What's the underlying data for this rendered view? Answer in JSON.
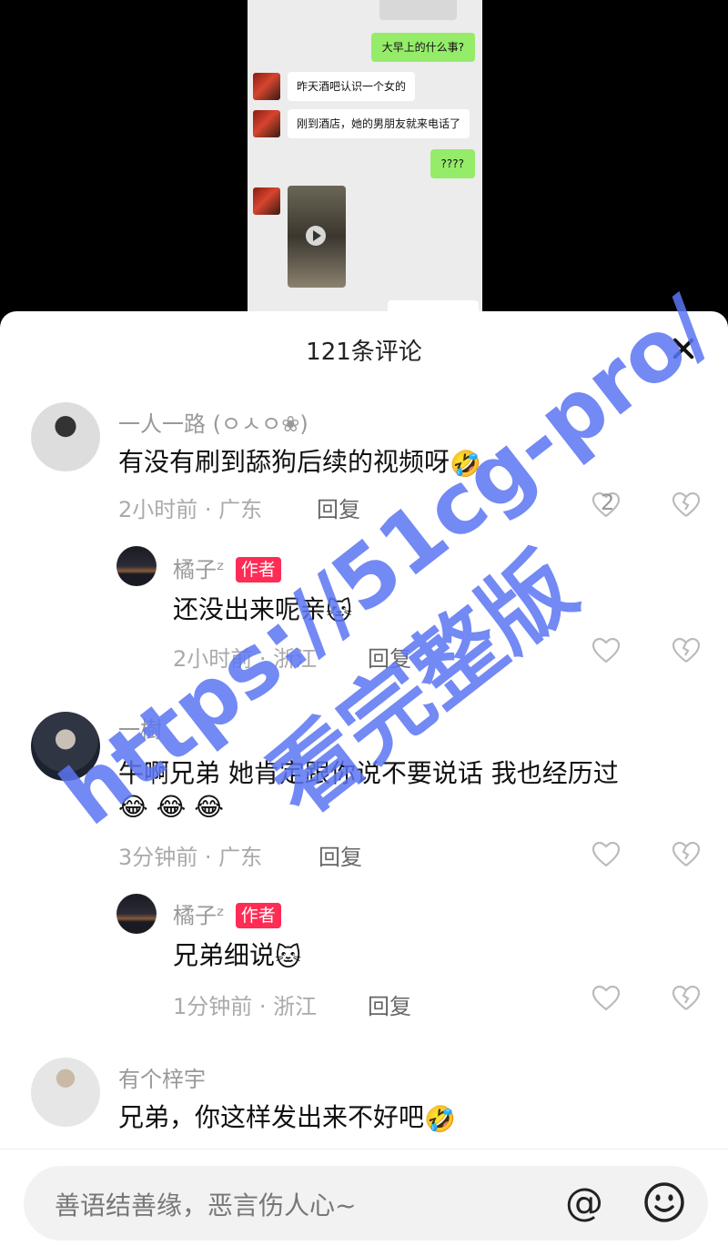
{
  "chat_screenshot": {
    "messages": [
      {
        "side": "out",
        "text": "大早上的什么事?"
      },
      {
        "side": "in",
        "text": "昨天酒吧认识一个女的"
      },
      {
        "side": "in",
        "text": "刚到酒店，她的男朋友就来电话了"
      },
      {
        "side": "out",
        "text": "????"
      }
    ]
  },
  "sheet": {
    "title": "121条评论"
  },
  "comments": [
    {
      "username": "一人一路 (ㅇㅅㅇ❀)",
      "text": "有没有刷到舔狗后续的视频呀",
      "emoji": "🤣",
      "time_location": "2小时前 · 广东",
      "reply_label": "回复",
      "likes": "2",
      "replies": [
        {
          "username": "橘子ᶻ",
          "badge": "作者",
          "text": "还没出来呢亲",
          "emoji": "🐱",
          "time_location": "2小时前 · 浙江",
          "reply_label": "回复"
        }
      ]
    },
    {
      "username": "一樹",
      "text": "牛啊兄弟 她肯定跟你说不要说话 我也经历过",
      "emoji": "😂 😂 😂",
      "time_location": "3分钟前 · 广东",
      "reply_label": "回复",
      "replies": [
        {
          "username": "橘子ᶻ",
          "badge": "作者",
          "text": "兄弟细说",
          "emoji": "🐱",
          "time_location": "1分钟前 · 浙江",
          "reply_label": "回复"
        }
      ]
    },
    {
      "username": "有个梓宇",
      "text": "兄弟，你这样发出来不好吧",
      "emoji": "🤣"
    }
  ],
  "input": {
    "placeholder": "善语结善缘，恶言伤人心~",
    "at_symbol": "@"
  },
  "watermark": {
    "line1": "https://51cg-pro/",
    "line2": "看完整版",
    "color": "#5b74f2"
  },
  "icons": [
    "close-icon",
    "heart-icon",
    "broken-heart-icon",
    "at-icon",
    "smiley-icon",
    "play-icon"
  ]
}
